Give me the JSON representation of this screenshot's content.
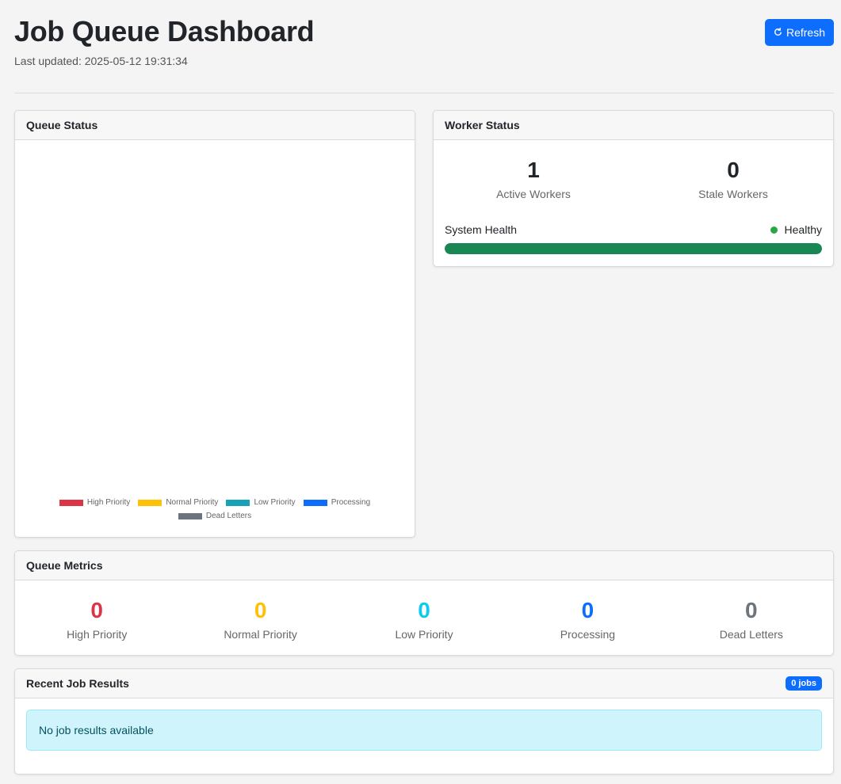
{
  "header": {
    "title": "Job Queue Dashboard",
    "last_updated": "Last updated: 2025-05-12 19:31:34",
    "refresh_label": "Refresh"
  },
  "queue_status": {
    "title": "Queue Status",
    "legend": [
      {
        "label": "High Priority",
        "color": "#dc3545"
      },
      {
        "label": "Normal Priority",
        "color": "#ffc107"
      },
      {
        "label": "Low Priority",
        "color": "#17a2b8"
      },
      {
        "label": "Processing",
        "color": "#0d6efd"
      },
      {
        "label": "Dead Letters",
        "color": "#6c757d"
      }
    ]
  },
  "chart_data": {
    "type": "bar",
    "categories": [
      "High Priority",
      "Normal Priority",
      "Low Priority",
      "Processing",
      "Dead Letters"
    ],
    "values": [
      0,
      0,
      0,
      0,
      0
    ],
    "legend_position": "bottom"
  },
  "worker_status": {
    "title": "Worker Status",
    "active_workers": "1",
    "active_label": "Active Workers",
    "stale_workers": "0",
    "stale_label": "Stale Workers",
    "health_label": "System Health",
    "health_status": "Healthy",
    "health_color": "#198754",
    "health_level": 1.0
  },
  "queue_metrics": {
    "title": "Queue Metrics",
    "items": [
      {
        "value": "0",
        "label": "High Priority",
        "color": "#dc3545"
      },
      {
        "value": "0",
        "label": "Normal Priority",
        "color": "#ffc107"
      },
      {
        "value": "0",
        "label": "Low Priority",
        "color": "#0dcaf0"
      },
      {
        "value": "0",
        "label": "Processing",
        "color": "#0d6efd"
      },
      {
        "value": "0",
        "label": "Dead Letters",
        "color": "#6c757d"
      }
    ]
  },
  "recent_results": {
    "title": "Recent Job Results",
    "badge": "0 jobs",
    "empty_message": "No job results available"
  }
}
